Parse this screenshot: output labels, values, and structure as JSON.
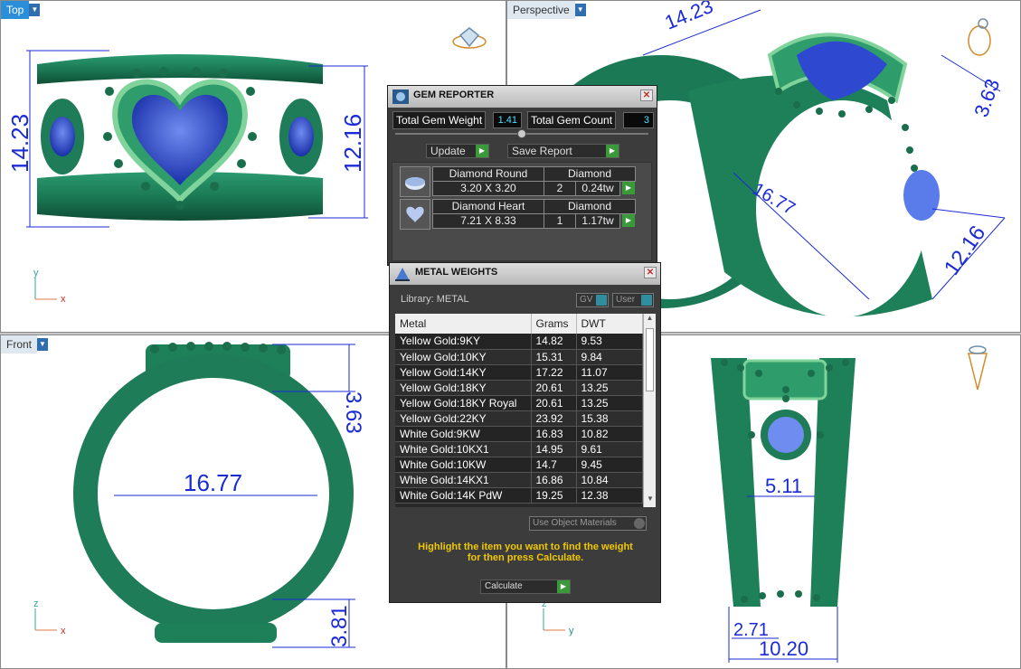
{
  "viewports": {
    "top": {
      "label": "Top",
      "dims": [
        "14.23",
        "12.16"
      ],
      "axes": [
        "y",
        "x"
      ]
    },
    "perspective": {
      "label": "Perspective",
      "dims": [
        "14.23",
        "3.63",
        "16.77",
        "12.16"
      ]
    },
    "front": {
      "label": "Front",
      "dims": [
        "16.77",
        "3.63",
        "3.81"
      ],
      "axes": [
        "z",
        "x"
      ]
    },
    "right": {
      "dims": [
        "5.11",
        "2.71",
        "10.20"
      ],
      "axes": [
        "z",
        "y"
      ]
    }
  },
  "gem_reporter": {
    "title": "GEM REPORTER",
    "total_weight_label": "Total Gem Weight",
    "total_weight_value": "1.41",
    "total_count_label": "Total Gem Count",
    "total_count_value": "3",
    "update_label": "Update",
    "save_report_label": "Save Report",
    "gems": [
      {
        "name": "Diamond Round",
        "size": "3.20 X 3.20",
        "material": "Diamond",
        "count": "2",
        "weight": "0.24tw"
      },
      {
        "name": "Diamond Heart",
        "size": "7.21 X 8.33",
        "material": "Diamond",
        "count": "1",
        "weight": "1.17tw"
      }
    ]
  },
  "metal_weights": {
    "title": "METAL WEIGHTS",
    "library_label": "Library: METAL",
    "gv_label": "GV",
    "user_label": "User",
    "headers": [
      "Metal",
      "Grams",
      "DWT"
    ],
    "rows": [
      [
        "Yellow Gold:9KY",
        "14.82",
        "9.53"
      ],
      [
        "Yellow Gold:10KY",
        "15.31",
        "9.84"
      ],
      [
        "Yellow Gold:14KY",
        "17.22",
        "11.07"
      ],
      [
        "Yellow Gold:18KY",
        "20.61",
        "13.25"
      ],
      [
        "Yellow Gold:18KY Royal",
        "20.61",
        "13.25"
      ],
      [
        "Yellow Gold:22KY",
        "23.92",
        "15.38"
      ],
      [
        "White Gold:9KW",
        "16.83",
        "10.82"
      ],
      [
        "White Gold:10KX1",
        "14.95",
        "9.61"
      ],
      [
        "White Gold:10KW",
        "14.7",
        "9.45"
      ],
      [
        "White Gold:14KX1",
        "16.86",
        "10.84"
      ],
      [
        "White Gold:14K PdW",
        "19.25",
        "12.38"
      ]
    ],
    "use_object_materials_label": "Use Object Materials",
    "hint_line1": "Highlight the item you want to find the weight",
    "hint_line2": "for then press Calculate.",
    "calculate_label": "Calculate"
  }
}
